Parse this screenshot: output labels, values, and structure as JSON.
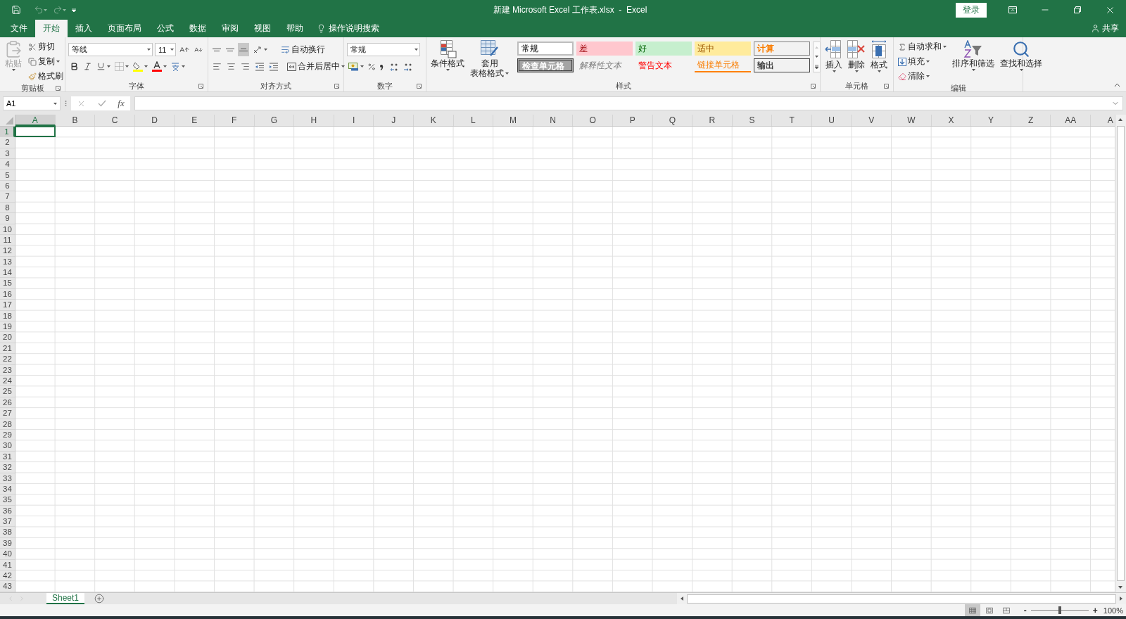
{
  "title_bar": {
    "title": "新建 Microsoft Excel 工作表.xlsx  -  Excel",
    "sign_in": "登录"
  },
  "ribbon_tabs": [
    {
      "label": "文件",
      "selected": false
    },
    {
      "label": "开始",
      "selected": true
    },
    {
      "label": "插入",
      "selected": false
    },
    {
      "label": "页面布局",
      "selected": false
    },
    {
      "label": "公式",
      "selected": false
    },
    {
      "label": "数据",
      "selected": false
    },
    {
      "label": "审阅",
      "selected": false
    },
    {
      "label": "视图",
      "selected": false
    },
    {
      "label": "帮助",
      "selected": false
    }
  ],
  "tell_me": "操作说明搜索",
  "share": "共享",
  "clipboard": {
    "label": "剪贴板",
    "paste": {
      "label": "粘贴",
      "disabled": true
    },
    "cut": "剪切",
    "copy": "复制",
    "format_painter": "格式刷"
  },
  "font": {
    "label": "字体",
    "name": "等线",
    "size": "11"
  },
  "alignment": {
    "label": "对齐方式",
    "wrap": "自动换行",
    "merge": "合并后居中"
  },
  "number": {
    "label": "数字",
    "format": "常规"
  },
  "styles": {
    "label": "样式",
    "conditional": "条件格式",
    "table_format_1": "套用",
    "table_format_2": "表格格式",
    "items": [
      {
        "label": "常规",
        "kind": "normal"
      },
      {
        "label": "差",
        "kind": "bad"
      },
      {
        "label": "好",
        "kind": "good"
      },
      {
        "label": "适中",
        "kind": "neutral"
      },
      {
        "label": "计算",
        "kind": "calculation"
      },
      {
        "label": "检查单元格",
        "kind": "check"
      },
      {
        "label": "解释性文本",
        "kind": "explanatory"
      },
      {
        "label": "警告文本",
        "kind": "warning"
      },
      {
        "label": "链接单元格",
        "kind": "linked"
      },
      {
        "label": "输出",
        "kind": "output"
      }
    ]
  },
  "cells": {
    "label": "单元格",
    "insert": "插入",
    "delete": "删除",
    "format": "格式"
  },
  "editing": {
    "label": "编辑",
    "autosum": "自动求和",
    "fill": "填充",
    "clear": "清除",
    "sort": "排序和筛选",
    "find": "查找和选择"
  },
  "formula_bar": {
    "name_box": "A1",
    "fx": "fx"
  },
  "columns": [
    {
      "label": "A",
      "selected": true
    },
    {
      "label": "B",
      "selected": false
    },
    {
      "label": "C",
      "selected": false
    },
    {
      "label": "D",
      "selected": false
    },
    {
      "label": "E",
      "selected": false
    },
    {
      "label": "F",
      "selected": false
    },
    {
      "label": "G",
      "selected": false
    },
    {
      "label": "H",
      "selected": false
    },
    {
      "label": "I",
      "selected": false
    },
    {
      "label": "J",
      "selected": false
    },
    {
      "label": "K",
      "selected": false
    },
    {
      "label": "L",
      "selected": false
    },
    {
      "label": "M",
      "selected": false
    },
    {
      "label": "N",
      "selected": false
    },
    {
      "label": "O",
      "selected": false
    },
    {
      "label": "P",
      "selected": false
    },
    {
      "label": "Q",
      "selected": false
    },
    {
      "label": "R",
      "selected": false
    },
    {
      "label": "S",
      "selected": false
    },
    {
      "label": "T",
      "selected": false
    },
    {
      "label": "U",
      "selected": false
    },
    {
      "label": "V",
      "selected": false
    },
    {
      "label": "W",
      "selected": false
    },
    {
      "label": "X",
      "selected": false
    },
    {
      "label": "Y",
      "selected": false
    },
    {
      "label": "Z",
      "selected": false
    },
    {
      "label": "AA",
      "selected": false
    },
    {
      "label": "A",
      "selected": false
    }
  ],
  "rows": [
    {
      "label": "1",
      "selected": true
    },
    {
      "label": "2",
      "selected": false
    },
    {
      "label": "3",
      "selected": false
    },
    {
      "label": "4",
      "selected": false
    },
    {
      "label": "5",
      "selected": false
    },
    {
      "label": "6",
      "selected": false
    },
    {
      "label": "7",
      "selected": false
    },
    {
      "label": "8",
      "selected": false
    },
    {
      "label": "9",
      "selected": false
    },
    {
      "label": "10",
      "selected": false
    },
    {
      "label": "11",
      "selected": false
    },
    {
      "label": "12",
      "selected": false
    },
    {
      "label": "13",
      "selected": false
    },
    {
      "label": "14",
      "selected": false
    },
    {
      "label": "15",
      "selected": false
    },
    {
      "label": "16",
      "selected": false
    },
    {
      "label": "17",
      "selected": false
    },
    {
      "label": "18",
      "selected": false
    },
    {
      "label": "19",
      "selected": false
    },
    {
      "label": "20",
      "selected": false
    },
    {
      "label": "21",
      "selected": false
    },
    {
      "label": "22",
      "selected": false
    },
    {
      "label": "23",
      "selected": false
    },
    {
      "label": "24",
      "selected": false
    },
    {
      "label": "25",
      "selected": false
    },
    {
      "label": "26",
      "selected": false
    },
    {
      "label": "27",
      "selected": false
    },
    {
      "label": "28",
      "selected": false
    },
    {
      "label": "29",
      "selected": false
    },
    {
      "label": "30",
      "selected": false
    },
    {
      "label": "31",
      "selected": false
    },
    {
      "label": "32",
      "selected": false
    },
    {
      "label": "33",
      "selected": false
    },
    {
      "label": "34",
      "selected": false
    },
    {
      "label": "35",
      "selected": false
    },
    {
      "label": "36",
      "selected": false
    },
    {
      "label": "37",
      "selected": false
    },
    {
      "label": "38",
      "selected": false
    },
    {
      "label": "39",
      "selected": false
    },
    {
      "label": "40",
      "selected": false
    },
    {
      "label": "41",
      "selected": false
    },
    {
      "label": "42",
      "selected": false
    },
    {
      "label": "43",
      "selected": false
    }
  ],
  "sheets": [
    {
      "label": "Sheet1",
      "selected": true
    }
  ],
  "status_bar": {
    "views": [
      {
        "kind": "normal",
        "selected": true
      },
      {
        "kind": "page_layout",
        "selected": false
      },
      {
        "kind": "page_break",
        "selected": false
      }
    ],
    "zoom_out": "-",
    "zoom_in": "+",
    "zoom": {
      "level": 0.5,
      "reading": "100%"
    }
  }
}
